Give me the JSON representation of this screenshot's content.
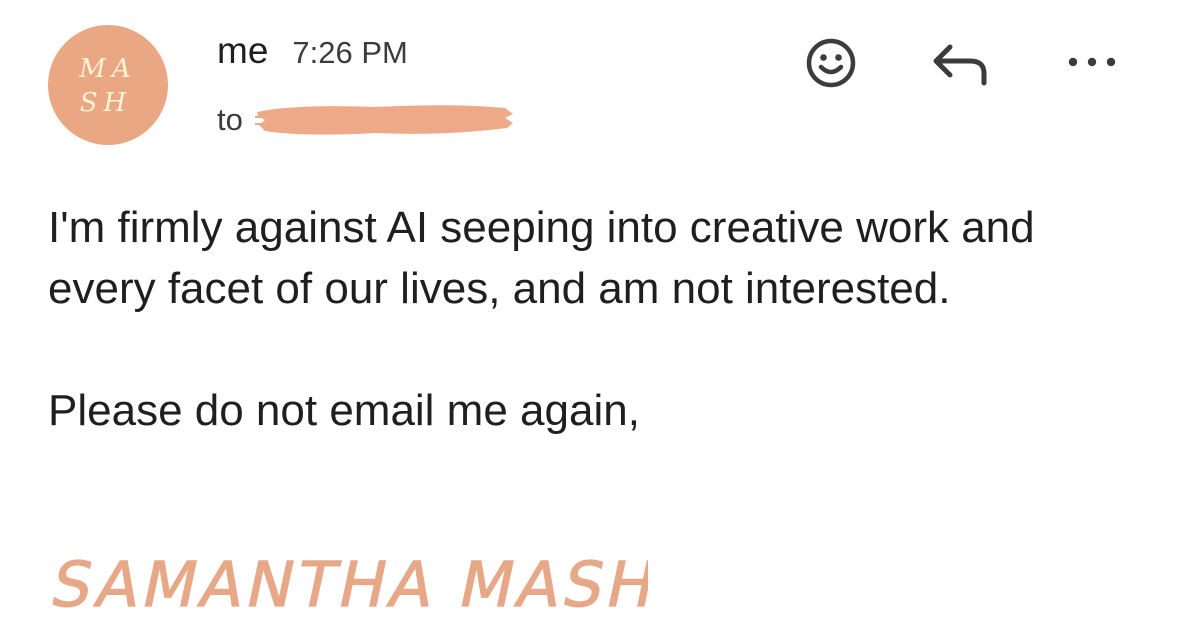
{
  "avatar": {
    "monogram_line1": "MA",
    "monogram_line2": "SH",
    "background_color": "#e9a783",
    "text_color": "#fff3d6"
  },
  "message": {
    "sender": "me",
    "time": "7:26 PM",
    "to_label": "to",
    "recipient_redacted": true,
    "redaction_color": "#eeaa88"
  },
  "actions": {
    "emoji_icon": "smiley-face-icon",
    "reply_icon": "reply-arrow-icon",
    "more_icon": "more-dots-icon"
  },
  "body": {
    "paragraph_1": "I'm firmly against AI seeping into creative work and every facet of our lives, and am not interested.",
    "paragraph_2": "Please do not email me again,"
  },
  "signature": {
    "text": "SAMANTHA MASH",
    "color": "#e7a888"
  }
}
